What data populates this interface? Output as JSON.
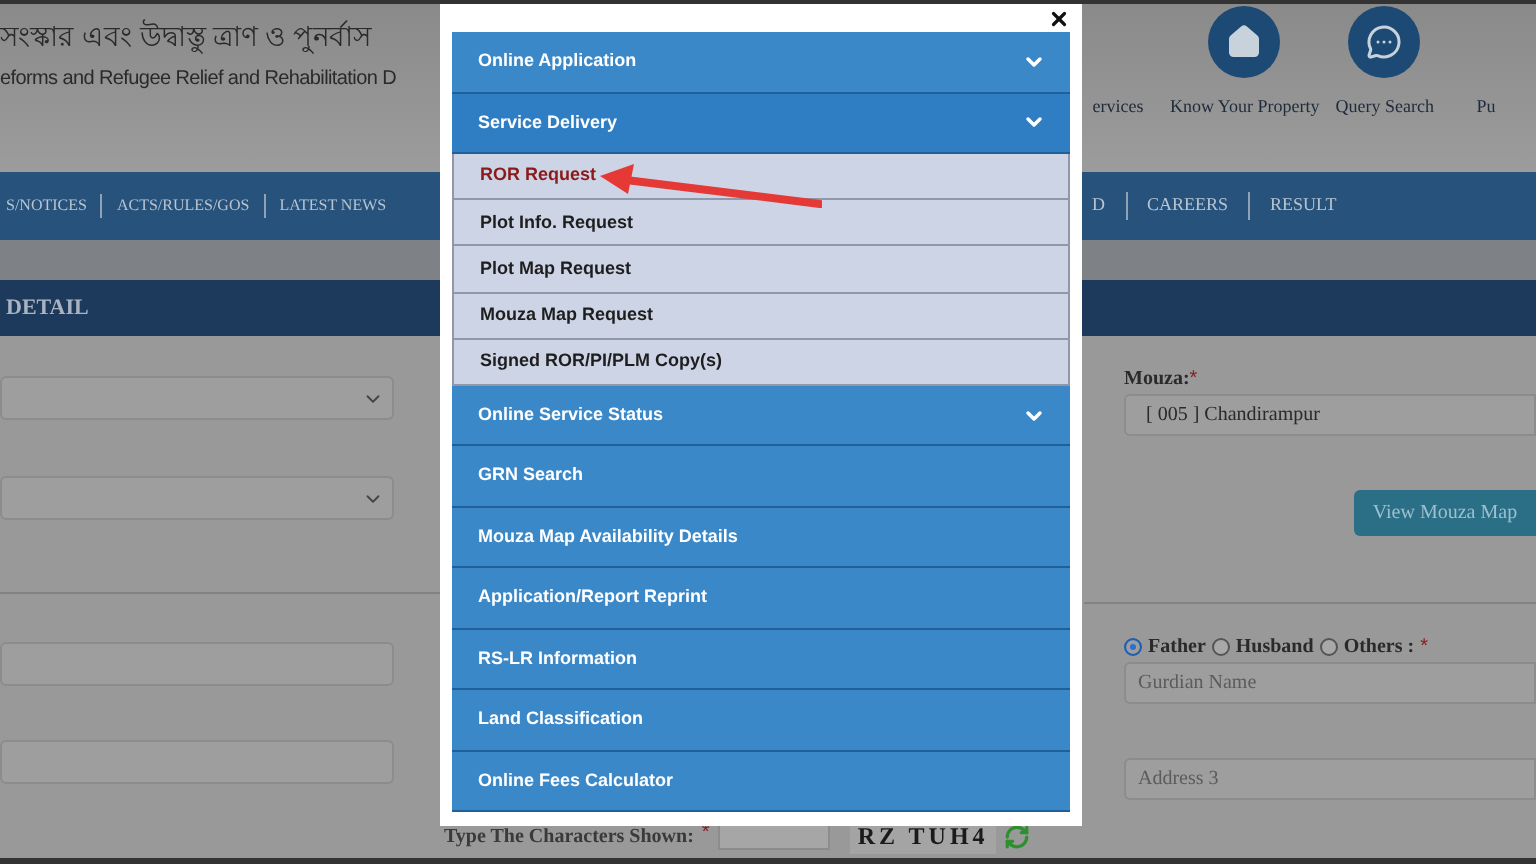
{
  "header": {
    "title": "সংস্কার এবং উদ্বাস্তু ত্রাণ ও পুনর্বাস",
    "subtitle": "eforms and Refugee Relief and Rehabilitation D",
    "links": [
      {
        "label": "ervices",
        "kind": "none"
      },
      {
        "label": "Know Your Property",
        "kind": "home"
      },
      {
        "label": "Query Search",
        "kind": "chat"
      },
      {
        "label": "Pu",
        "kind": "none"
      }
    ]
  },
  "nav": {
    "left": [
      "S/NOTICES",
      "ACTS/RULES/GOS",
      "LATEST NEWS"
    ],
    "right": [
      "D",
      "CAREERS",
      "RESULT"
    ]
  },
  "section_title": "DETAIL",
  "form": {
    "left_fields": [
      {
        "kind": "select"
      },
      {
        "kind": "select"
      },
      {
        "kind": "divider"
      },
      {
        "kind": "input"
      },
      {
        "kind": "input"
      }
    ],
    "mouza_label": "Mouza:",
    "mouza_required": "*",
    "mouza_value": "[ 005 ] Chandirampur",
    "view_button": "View Mouza Map",
    "relation_options": [
      {
        "label": "Father",
        "selected": true
      },
      {
        "label": "Husband",
        "selected": false
      },
      {
        "label": "Others :",
        "selected": false
      }
    ],
    "relation_required": "*",
    "guardian_placeholder": "Gurdian Name",
    "address_placeholder": "Address 3",
    "captcha_label": "Type The Characters Shown:",
    "captcha_required": "*",
    "captcha_code": "RZ TUH4"
  },
  "modal": {
    "menu": [
      {
        "label": "Online Application",
        "expandable": true,
        "expanded": false
      },
      {
        "label": "Service Delivery",
        "expandable": true,
        "expanded": true,
        "children": [
          {
            "label": "ROR Request",
            "selected": true
          },
          {
            "label": "Plot Info. Request",
            "selected": false
          },
          {
            "label": "Plot Map Request",
            "selected": false
          },
          {
            "label": "Mouza Map Request",
            "selected": false
          },
          {
            "label": "Signed ROR/PI/PLM Copy(s)",
            "selected": false
          }
        ]
      },
      {
        "label": "Online Service Status",
        "expandable": true,
        "expanded": false
      },
      {
        "label": "GRN Search",
        "expandable": false,
        "expanded": false
      },
      {
        "label": "Mouza Map Availability Details",
        "expandable": false,
        "expanded": false
      },
      {
        "label": "Application/Report Reprint",
        "expandable": false,
        "expanded": false
      },
      {
        "label": "RS-LR Information",
        "expandable": false,
        "expanded": false
      },
      {
        "label": "Land Classification",
        "expandable": false,
        "expanded": false
      },
      {
        "label": "Online Fees Calculator",
        "expandable": false,
        "expanded": false
      }
    ]
  }
}
